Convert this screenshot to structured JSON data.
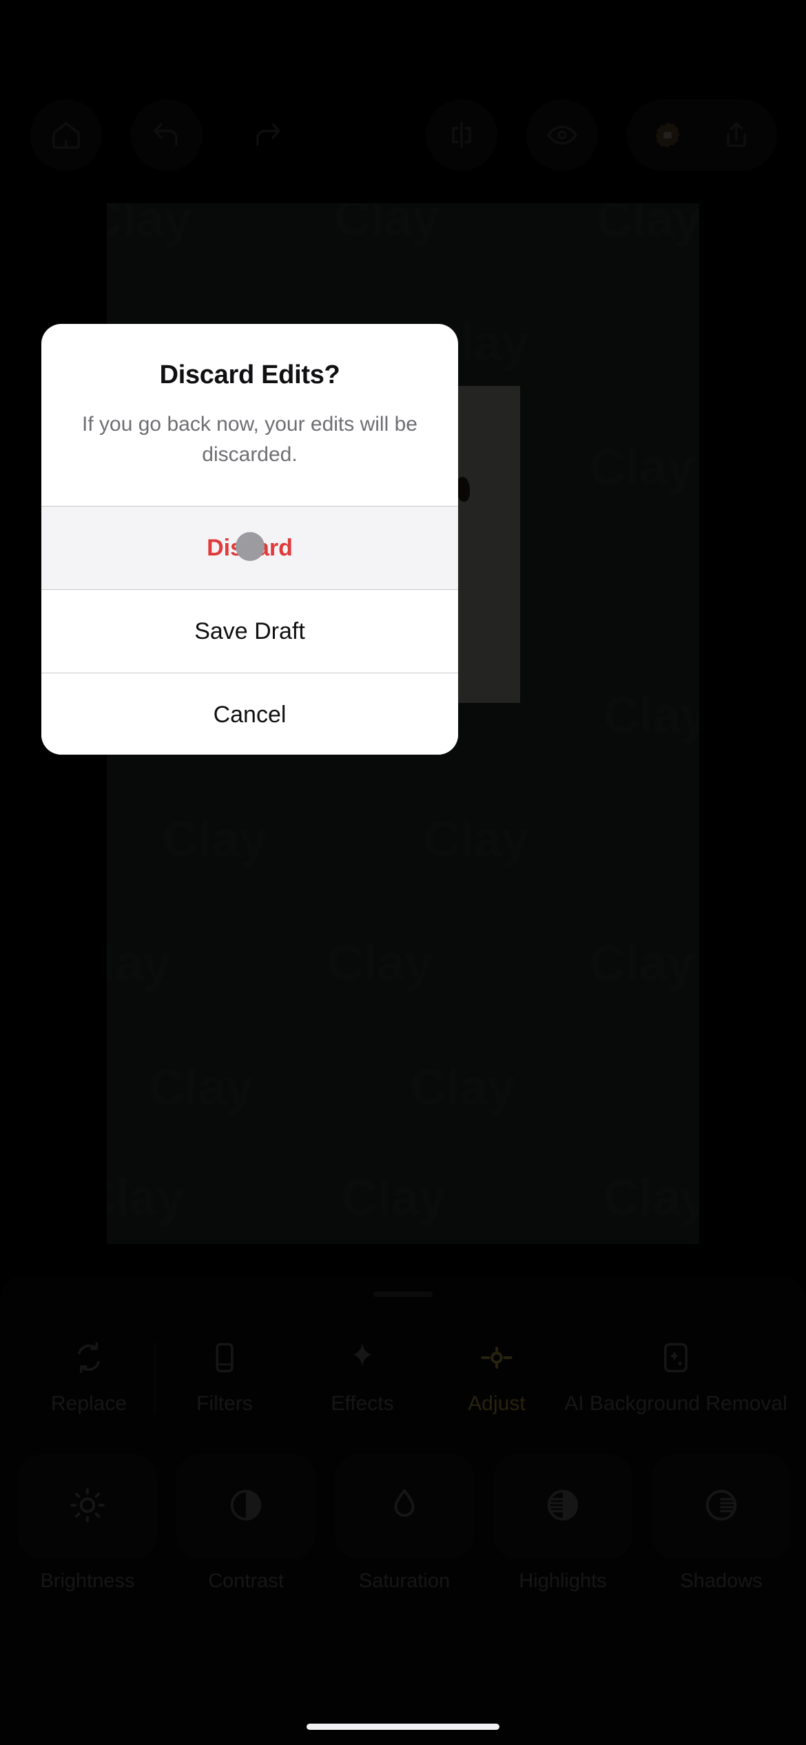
{
  "app": {
    "canvas_watermark": "Clay"
  },
  "toolbar": {
    "items": [
      {
        "name": "home",
        "icon": "home-icon"
      },
      {
        "name": "undo",
        "icon": "undo-icon"
      },
      {
        "name": "redo",
        "icon": "redo-icon"
      },
      {
        "name": "compare",
        "icon": "compare-split-icon"
      },
      {
        "name": "preview",
        "icon": "eye-icon"
      },
      {
        "name": "pro-badge",
        "icon": "premium-badge-icon"
      },
      {
        "name": "share",
        "icon": "share-icon"
      }
    ],
    "accent_badge_color": "#6b4b33"
  },
  "sheet": {
    "tabs": [
      {
        "label": "Replace",
        "icon": "replace-icon",
        "selected": false
      },
      {
        "label": "Filters",
        "icon": "filters-icon",
        "selected": false
      },
      {
        "label": "Effects",
        "icon": "effects-sparkle-icon",
        "selected": false
      },
      {
        "label": "Adjust",
        "icon": "adjust-slider-icon",
        "selected": true
      },
      {
        "label": "AI Background Removal",
        "icon": "ai-background-icon",
        "selected": false
      }
    ],
    "selected_tab_color": "#c8b34a",
    "tools": [
      {
        "label": "Brightness",
        "icon": "brightness-sun-icon"
      },
      {
        "label": "Contrast",
        "icon": "contrast-half-circle-icon"
      },
      {
        "label": "Saturation",
        "icon": "saturation-droplet-icon"
      },
      {
        "label": "Highlights",
        "icon": "highlights-icon"
      },
      {
        "label": "Shadows",
        "icon": "shadows-icon"
      }
    ]
  },
  "dialog": {
    "title": "Discard Edits?",
    "message": "If you go back now, your edits will be discarded.",
    "buttons": [
      {
        "label": "Discard",
        "style": "destructive",
        "pressed": true,
        "color": "#e03a3a"
      },
      {
        "label": "Save Draft",
        "style": "default",
        "pressed": false
      },
      {
        "label": "Cancel",
        "style": "default",
        "pressed": false
      }
    ]
  }
}
